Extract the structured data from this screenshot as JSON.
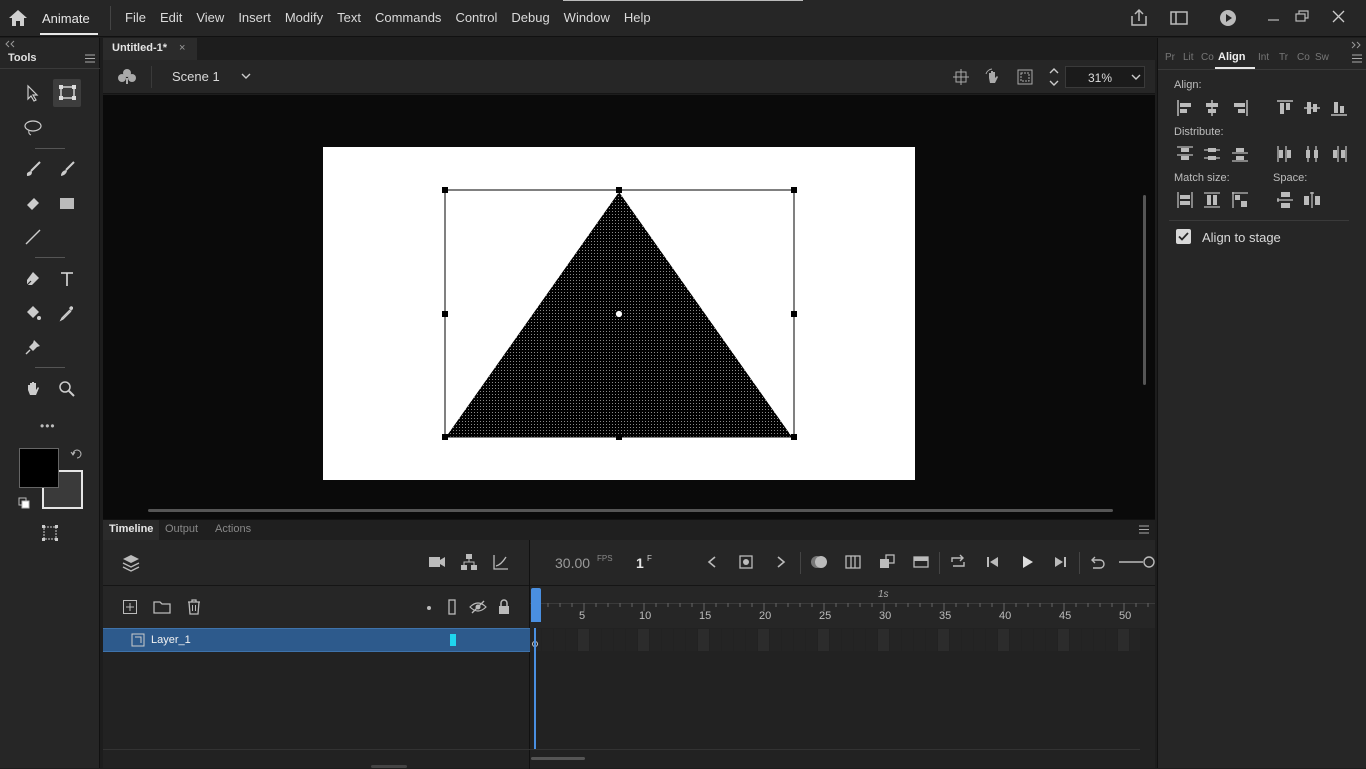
{
  "menubar": {
    "app_name": "Animate",
    "menus": [
      "File",
      "Edit",
      "View",
      "Insert",
      "Modify",
      "Text",
      "Commands",
      "Control",
      "Debug",
      "Window",
      "Help"
    ]
  },
  "tools": {
    "title": "Tools",
    "more": "•••"
  },
  "document": {
    "tab_title": "Untitled-1*",
    "tab_close": "×",
    "scene": "Scene 1",
    "zoom": "31%"
  },
  "timeline": {
    "tabs": [
      "Timeline",
      "Output",
      "Actions"
    ],
    "fps": "30.00",
    "fps_unit": "FPS",
    "frame": "1",
    "frame_unit": "F",
    "second_marker": "1s",
    "frame_labels": [
      "5",
      "10",
      "15",
      "20",
      "25",
      "30",
      "35",
      "40",
      "45",
      "50"
    ],
    "layer_name": "Layer_1"
  },
  "align_panel": {
    "tabs": [
      "Pr",
      "Lit",
      "Co",
      "Align",
      "Int",
      "Tr",
      "Co",
      "Sw"
    ],
    "align_label": "Align:",
    "distribute_label": "Distribute:",
    "match_size_label": "Match size:",
    "space_label": "Space:",
    "align_to_stage_label": "Align to stage",
    "align_to_stage_checked": true
  },
  "colors": {
    "stroke": "#000000",
    "fill": "#3a3a3a",
    "selection_blue": "#2d5a8c",
    "playhead": "#4a8fe0",
    "layer_color": "#1fd6f0"
  }
}
